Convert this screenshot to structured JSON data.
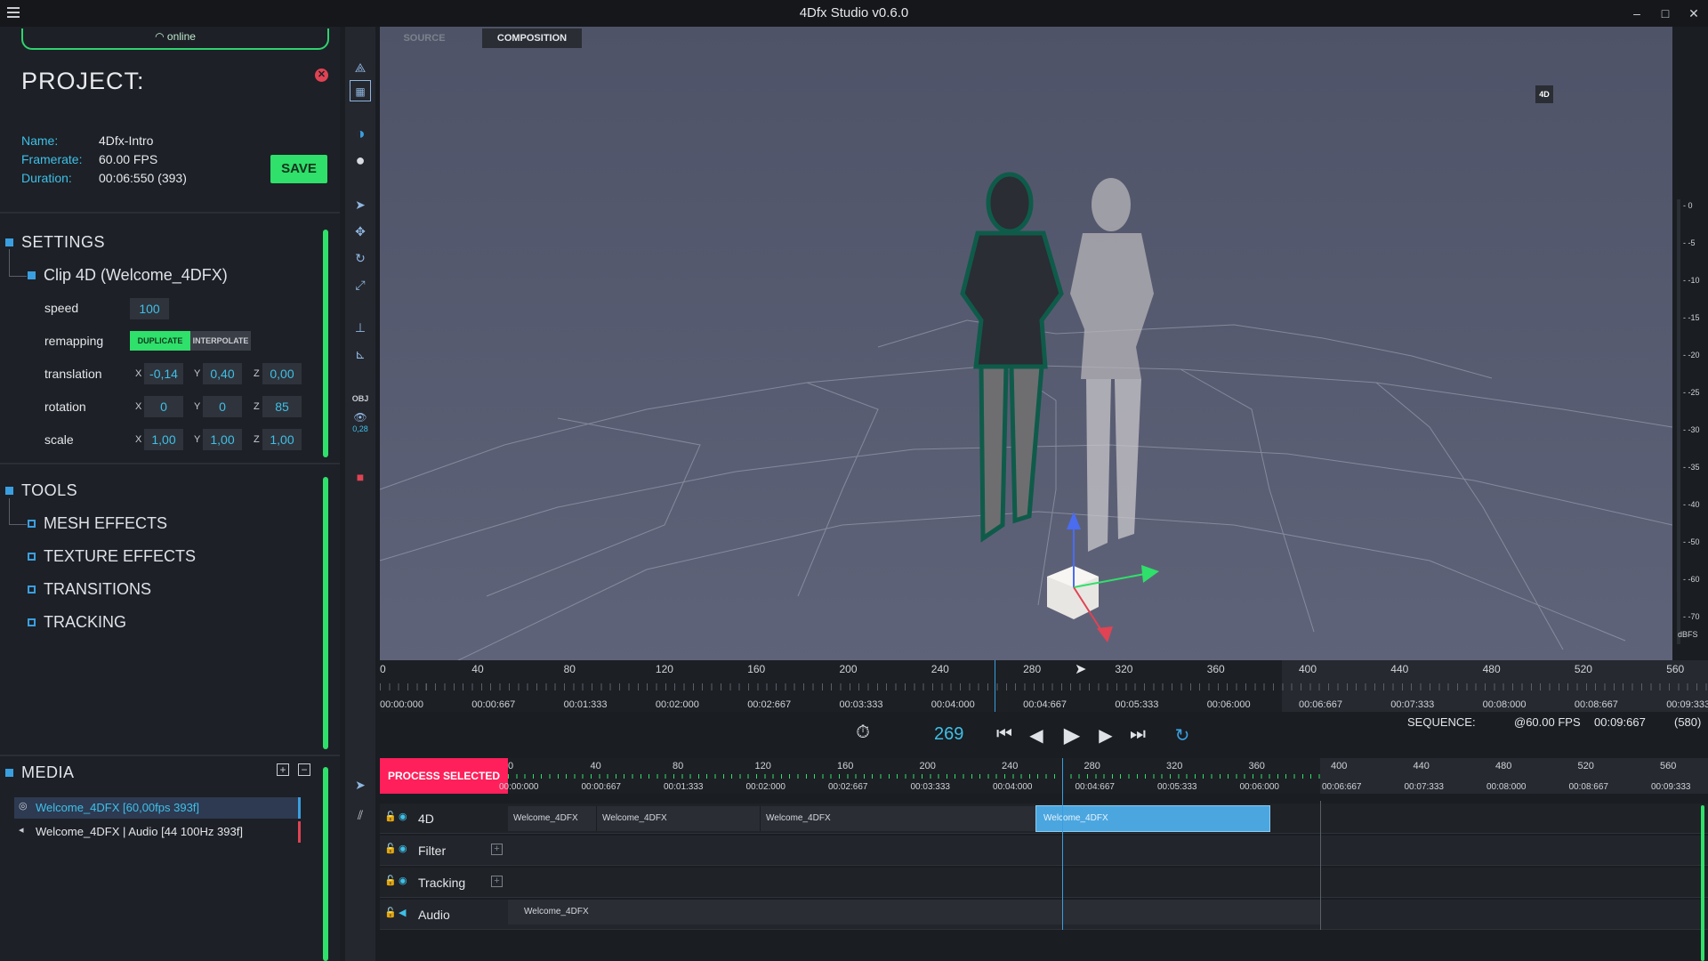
{
  "window": {
    "title": "4Dfx Studio v0.6.0",
    "minimize": "–",
    "maximize": "□",
    "close": "✕"
  },
  "status": {
    "online": "online"
  },
  "project": {
    "title": "PROJECT:",
    "name_key": "Name:",
    "name_val": "4Dfx-Intro",
    "framerate_key": "Framerate:",
    "framerate_val": "60.00 FPS",
    "duration_key": "Duration:",
    "duration_val": "00:06:550 (393)",
    "save": "SAVE"
  },
  "settings": {
    "title": "SETTINGS",
    "clip": "Clip 4D (Welcome_4DFX)",
    "speed_label": "speed",
    "speed": "100",
    "remapping_label": "remapping",
    "duplicate": "DUPLICATE",
    "interpolate": "INTERPOLATE",
    "translation_label": "translation",
    "tx": "-0,14",
    "ty": "0,40",
    "tz": "0,00",
    "rotation_label": "rotation",
    "rx": "0",
    "ry": "0",
    "rz": "85",
    "scale_label": "scale",
    "sx": "1,00",
    "sy": "1,00",
    "sz": "1,00",
    "x": "X",
    "y": "Y",
    "z": "Z"
  },
  "tools": {
    "title": "TOOLS",
    "items": [
      "MESH EFFECTS",
      "TEXTURE EFFECTS",
      "TRANSITIONS",
      "TRACKING"
    ]
  },
  "media": {
    "title": "MEDIA",
    "items": [
      "Welcome_4DFX [60,00fps 393f]",
      "Welcome_4DFX | Audio [44 100Hz 393f]"
    ]
  },
  "toolstrip": {
    "obj": "OBJ",
    "opacity": "0,28"
  },
  "viewport": {
    "tab_source": "SOURCE",
    "tab_composition": "COMPOSITION",
    "gizmo_label": "4D"
  },
  "meter": {
    "ticks": [
      "0",
      "-5",
      "-10",
      "-15",
      "-20",
      "-25",
      "-30",
      "-35",
      "-40",
      "-50",
      "-60",
      "-70"
    ],
    "unit": "dBFS"
  },
  "source_ruler": {
    "frames": [
      "0",
      "40",
      "80",
      "120",
      "160",
      "200",
      "240",
      "280",
      "320",
      "360",
      "400",
      "440",
      "480",
      "520",
      "560"
    ],
    "times": [
      "00:00:000",
      "00:00:667",
      "00:01:333",
      "00:02:000",
      "00:02:667",
      "00:03:333",
      "00:04:000",
      "00:04:667",
      "00:05:333",
      "00:06:000",
      "00:06:667",
      "00:07:333",
      "00:08:000",
      "00:08:667",
      "00:09:333"
    ]
  },
  "playback": {
    "frame": "269",
    "sequence_label": "SEQUENCE:",
    "fps": "@60.00 FPS",
    "time": "00:09:667",
    "frames": "(580)"
  },
  "composition": {
    "process_selected": "PROCESS SELECTED",
    "frames": [
      "0",
      "40",
      "80",
      "120",
      "160",
      "200",
      "240",
      "280",
      "320",
      "360",
      "400",
      "440",
      "480",
      "520",
      "560"
    ],
    "times": [
      "00:00:000",
      "00:00:667",
      "00:01:333",
      "00:02:000",
      "00:02:667",
      "00:03:333",
      "00:04:000",
      "00:04:667",
      "00:05:333",
      "00:06:000",
      "00:06:667",
      "00:07:333",
      "00:08:000",
      "00:08:667",
      "00:09:333"
    ],
    "tracks": [
      "4D",
      "Filter",
      "Tracking",
      "Audio"
    ],
    "clip_name": "Welcome_4DFX"
  },
  "colors": {
    "accent_green": "#2fe06a",
    "accent_blue": "#3ec0e8",
    "alert_red": "#ff1f5a",
    "selected_clip": "#4ba6e0"
  }
}
